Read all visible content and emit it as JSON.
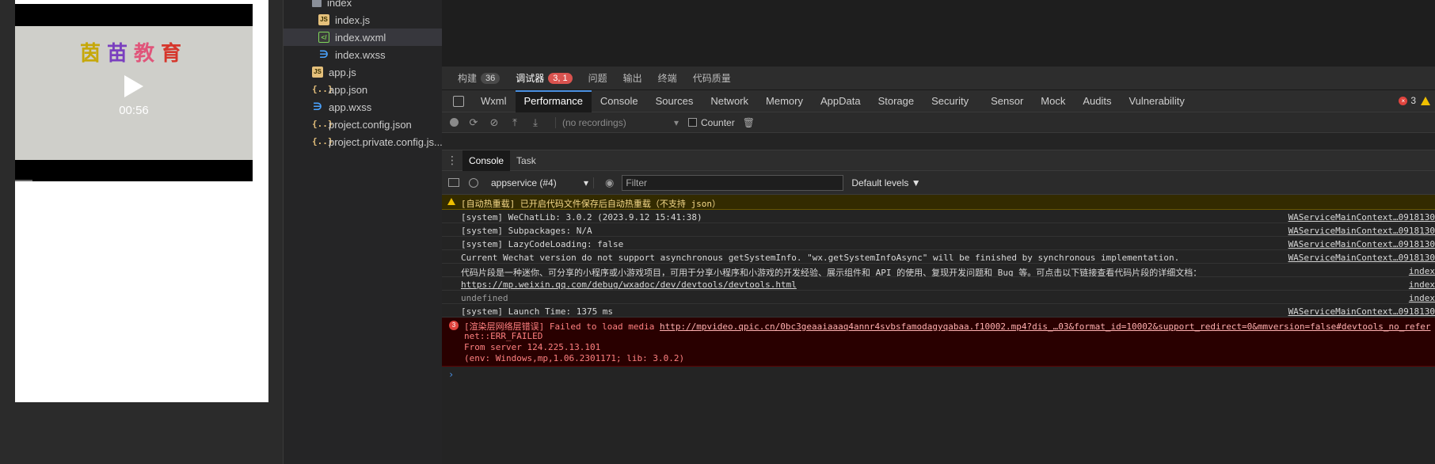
{
  "simulator": {
    "brand_chars": [
      "茵",
      "苗",
      "教",
      "育"
    ],
    "brand_colors": [
      "#c6a80a",
      "#7a3fbf",
      "#e0557a",
      "#d6362b"
    ],
    "video_time": "00:56"
  },
  "filetree": {
    "items": [
      {
        "label": "index",
        "type": "folder"
      },
      {
        "label": "index.js",
        "type": "js"
      },
      {
        "label": "index.wxml",
        "type": "wxml",
        "selected": true
      },
      {
        "label": "index.wxss",
        "type": "wxss"
      },
      {
        "label": "app.js",
        "type": "js"
      },
      {
        "label": "app.json",
        "type": "json"
      },
      {
        "label": "app.wxss",
        "type": "wxss"
      },
      {
        "label": "project.config.json",
        "type": "json"
      },
      {
        "label": "project.private.config.js...",
        "type": "json"
      }
    ]
  },
  "main_tabs": {
    "build": {
      "label": "构建",
      "count": "36"
    },
    "debugger": {
      "label": "调试器",
      "count": "3, 1"
    },
    "issues": "问题",
    "output": "输出",
    "terminal": "终端",
    "quality": "代码质量"
  },
  "dev_tabs": [
    "Wxml",
    "Performance",
    "Console",
    "Sources",
    "Network",
    "Memory",
    "AppData",
    "Storage",
    "Security",
    "Sensor",
    "Mock",
    "Audits",
    "Vulnerability"
  ],
  "dev_tabs_active": "Performance",
  "error_count": "3",
  "perf": {
    "recordings": "(no recordings)",
    "counter": "Counter"
  },
  "drawer": {
    "console": "Console",
    "task": "Task"
  },
  "console_toolbar": {
    "context": "appservice (#4)",
    "filter_placeholder": "Filter",
    "levels": "Default levels ▼"
  },
  "messages": [
    {
      "kind": "warn",
      "text": "[自动热重载] 已开启代码文件保存后自动热重载（不支持 json）",
      "src": ""
    },
    {
      "kind": "log",
      "text": "[system] WeChatLib: 3.0.2 (2023.9.12 15:41:38)",
      "src": "WAServiceMainContext…0918130"
    },
    {
      "kind": "log",
      "text": "[system] Subpackages: N/A",
      "src": "WAServiceMainContext…0918130"
    },
    {
      "kind": "log",
      "text": "[system] LazyCodeLoading: false",
      "src": "WAServiceMainContext…0918130"
    },
    {
      "kind": "log",
      "text": "Current Wechat version do not support asynchronous getSystemInfo. \"wx.getSystemInfoAsync\" will be finished by synchronous implementation.",
      "src": "WAServiceMainContext…0918130"
    },
    {
      "kind": "log",
      "text": "代码片段是一种迷你、可分享的小程序或小游戏项目，可用于分享小程序和小游戏的开发经验、展示组件和 API 的使用、复现开发问题和 Bug 等。可点击以下链接查看代码片段的详细文档：",
      "src": "index"
    },
    {
      "kind": "link",
      "text": "https://mp.weixin.qq.com/debug/wxadoc/dev/devtools/devtools.html",
      "src": "index"
    },
    {
      "kind": "dim",
      "text": "undefined",
      "src": "index"
    },
    {
      "kind": "log",
      "text": "[system] Launch Time: 1375 ms",
      "src": "WAServiceMainContext…0918130"
    }
  ],
  "error_msg": {
    "badge": "3",
    "prefix": "[渲染层网络层错误] Failed to load media ",
    "url": "http://mpvideo.qpic.cn/0bc3geaaiaaaq4annr4svbsfamodagyqabaa.f10002.mp4?dis_…03&format_id=10002&support_redirect=0&mmversion=false#devtools_no_refer",
    "line2": "net::ERR_FAILED",
    "line3": "From server 124.225.13.101",
    "line4": "(env: Windows,mp,1.06.2301171; lib: 3.0.2)"
  },
  "prompt": "›"
}
